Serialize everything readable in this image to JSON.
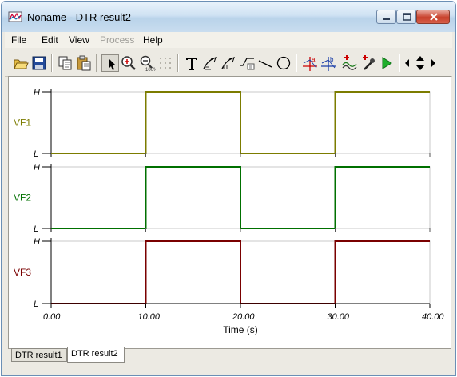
{
  "window": {
    "title": "Noname - DTR result2"
  },
  "menu": {
    "file": "File",
    "edit": "Edit",
    "view": "View",
    "process": "Process",
    "help": "Help"
  },
  "toolbar": {
    "icons": [
      "open-icon",
      "save-icon",
      "copy-icon",
      "paste-icon",
      "select-pointer-icon",
      "zoom-in-icon",
      "zoom-100-icon",
      "grid-icon",
      "text-icon",
      "curve-tool-icon",
      "curve-tool-2-icon",
      "wave-annotate-icon",
      "line-tool-icon",
      "circle-tool-icon",
      "cursor-a-icon",
      "cursor-b-icon",
      "add-wave-icon",
      "probe-icon",
      "run-icon",
      "scroll-left-icon",
      "scroll-updown-icon",
      "scroll-right-icon"
    ]
  },
  "chart_data": [
    {
      "type": "line",
      "series": [
        {
          "name": "VF1",
          "x": [
            0,
            10,
            10,
            20,
            20,
            30,
            30,
            40
          ],
          "values": [
            0,
            0,
            1,
            1,
            0,
            0,
            1,
            1
          ]
        }
      ],
      "ylabel": "VF1",
      "y_tick_labels": {
        "high": "H",
        "low": "L"
      },
      "color": "#7c7c00",
      "xlim": [
        0,
        40
      ]
    },
    {
      "type": "line",
      "series": [
        {
          "name": "VF2",
          "x": [
            0,
            10,
            10,
            20,
            20,
            30,
            30,
            40
          ],
          "values": [
            0,
            0,
            1,
            1,
            0,
            0,
            1,
            1
          ]
        }
      ],
      "ylabel": "VF2",
      "y_tick_labels": {
        "high": "H",
        "low": "L"
      },
      "color": "#007000",
      "xlim": [
        0,
        40
      ]
    },
    {
      "type": "line",
      "series": [
        {
          "name": "VF3",
          "x": [
            0,
            10,
            10,
            20,
            20,
            30,
            30,
            40
          ],
          "values": [
            0,
            0,
            1,
            1,
            0,
            0,
            1,
            1
          ]
        }
      ],
      "ylabel": "VF3",
      "y_tick_labels": {
        "high": "H",
        "low": "L"
      },
      "color": "#7a0000",
      "xlim": [
        0,
        40
      ],
      "x_tick_labels": [
        "0.00",
        "10.00",
        "20.00",
        "30.00",
        "40.00"
      ],
      "xlabel": "Time (s)"
    }
  ],
  "tabs": [
    "DTR result1",
    "DTR result2"
  ],
  "active_tab": 1
}
